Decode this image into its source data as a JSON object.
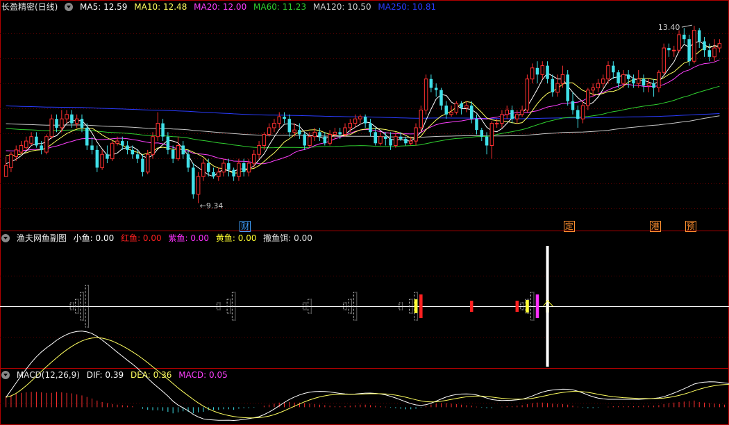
{
  "colors": {
    "bg": "#000000",
    "border": "#b00000",
    "grid": "#5a0000",
    "up": "#ff3030",
    "down": "#40e0e8",
    "ma5": "#ffffff",
    "ma10": "#ffff60",
    "ma20": "#ff40ff",
    "ma60": "#30d030",
    "ma120": "#c8c8c8",
    "ma250": "#2a3cff",
    "hong": "#ff2020",
    "zi": "#ff30ff",
    "huang": "#ffff30",
    "white": "#ffffff"
  },
  "main_header": {
    "title": "长盈精密(日线)",
    "ma5": "MA5: 12.59",
    "ma10": "MA10: 12.48",
    "ma20": "MA20: 12.00",
    "ma60": "MA60: 11.23",
    "ma120": "MA120: 10.50",
    "ma250": "MA250: 10.81"
  },
  "sub_header": {
    "title": "渔夫网鱼副图",
    "xiaoyu": "小鱼: 0.00",
    "hongyu": "红鱼: 0.00",
    "ziyu": "紫鱼: 0.00",
    "huangyu": "黄鱼: 0.00",
    "sayuer": "撒鱼饵: 0.00"
  },
  "macd_header": {
    "title": "MACD(12,26,9)",
    "dif": "DIF: 0.39",
    "dea": "DEA: 0.36",
    "macd": "MACD: 0.05"
  },
  "annotations": {
    "high_label": "13.40",
    "low_label": "9.34",
    "events": [
      {
        "text": "财",
        "bar": 47,
        "color": "#40a0ff"
      },
      {
        "text": "定",
        "bar": 111,
        "color": "#ff9030"
      },
      {
        "text": "港",
        "bar": 128,
        "color": "#ff9030"
      },
      {
        "text": "预",
        "bar": 135,
        "color": "#ff9030"
      }
    ]
  },
  "chart_data": [
    {
      "type": "candlestick",
      "name": "main",
      "y_range": [
        9.0,
        13.7
      ],
      "bars": [
        [
          10.0,
          10.25,
          10.1,
          10.45
        ],
        [
          10.2,
          10.5,
          10.1,
          10.55
        ],
        [
          10.45,
          10.6,
          10.35,
          10.7
        ],
        [
          10.55,
          10.7,
          10.5,
          10.8
        ],
        [
          10.65,
          10.8,
          10.6,
          10.9
        ],
        [
          10.75,
          10.9,
          10.7,
          11.0
        ],
        [
          10.9,
          10.7,
          10.65,
          11.0
        ],
        [
          10.7,
          10.6,
          10.5,
          10.8
        ],
        [
          10.55,
          10.9,
          10.5,
          10.95
        ],
        [
          10.9,
          11.3,
          10.85,
          11.4
        ],
        [
          11.3,
          11.1,
          11.0,
          11.4
        ],
        [
          11.1,
          11.3,
          11.0,
          11.5
        ],
        [
          11.3,
          11.4,
          11.2,
          11.5
        ],
        [
          11.4,
          11.2,
          11.1,
          11.5
        ],
        [
          11.2,
          11.3,
          11.1,
          11.4
        ],
        [
          11.3,
          11.1,
          11.0,
          11.4
        ],
        [
          11.1,
          10.7,
          10.6,
          11.2
        ],
        [
          10.7,
          10.6,
          10.5,
          10.9
        ],
        [
          10.6,
          10.2,
          10.1,
          10.7
        ],
        [
          10.2,
          10.5,
          10.15,
          10.6
        ],
        [
          10.5,
          10.4,
          10.3,
          10.7
        ],
        [
          10.4,
          10.75,
          10.35,
          10.8
        ],
        [
          10.75,
          10.8,
          10.7,
          10.9
        ],
        [
          10.8,
          10.7,
          10.6,
          10.9
        ],
        [
          10.7,
          10.6,
          10.5,
          10.8
        ],
        [
          10.6,
          10.5,
          10.4,
          10.7
        ],
        [
          10.5,
          10.4,
          10.3,
          10.6
        ],
        [
          10.4,
          10.1,
          10.0,
          10.5
        ],
        [
          10.1,
          10.5,
          10.05,
          10.6
        ],
        [
          10.5,
          10.9,
          10.4,
          11.0
        ],
        [
          10.9,
          11.2,
          10.8,
          11.45
        ],
        [
          11.2,
          10.9,
          10.8,
          11.3
        ],
        [
          10.9,
          10.6,
          10.5,
          11.0
        ],
        [
          10.6,
          10.4,
          10.3,
          10.7
        ],
        [
          10.4,
          10.7,
          10.35,
          10.9
        ],
        [
          10.7,
          10.5,
          10.4,
          10.8
        ],
        [
          10.5,
          10.2,
          10.1,
          10.6
        ],
        [
          10.2,
          9.6,
          9.5,
          10.3
        ],
        [
          9.6,
          10.0,
          9.4,
          10.1
        ],
        [
          10.0,
          10.3,
          9.9,
          10.4
        ],
        [
          10.3,
          10.1,
          10.0,
          10.4
        ],
        [
          10.1,
          10.0,
          9.95,
          10.2
        ],
        [
          10.0,
          10.1,
          9.9,
          10.2
        ],
        [
          10.1,
          10.3,
          10.0,
          10.4
        ],
        [
          10.3,
          10.15,
          10.0,
          10.4
        ],
        [
          10.15,
          10.0,
          9.9,
          10.2
        ],
        [
          10.0,
          10.3,
          9.9,
          10.4
        ],
        [
          10.3,
          10.1,
          10.0,
          10.4
        ],
        [
          10.1,
          10.3,
          10.0,
          10.4
        ],
        [
          10.3,
          10.5,
          10.2,
          10.6
        ],
        [
          10.5,
          10.7,
          10.4,
          10.8
        ],
        [
          10.7,
          10.95,
          10.6,
          11.0
        ],
        [
          10.95,
          11.1,
          10.9,
          11.2
        ],
        [
          11.1,
          11.2,
          11.0,
          11.3
        ],
        [
          11.2,
          11.35,
          11.1,
          11.45
        ],
        [
          11.35,
          11.3,
          11.2,
          11.45
        ],
        [
          11.3,
          11.0,
          10.9,
          11.4
        ],
        [
          11.0,
          11.05,
          10.9,
          11.2
        ],
        [
          11.05,
          10.95,
          10.85,
          11.2
        ],
        [
          10.95,
          10.7,
          10.6,
          11.0
        ],
        [
          10.7,
          10.9,
          10.65,
          11.0
        ],
        [
          10.9,
          11.0,
          10.8,
          11.1
        ],
        [
          11.0,
          10.9,
          10.8,
          11.1
        ],
        [
          10.9,
          10.75,
          10.7,
          11.0
        ],
        [
          10.75,
          10.95,
          10.7,
          11.05
        ],
        [
          10.95,
          11.0,
          10.85,
          11.1
        ],
        [
          11.0,
          10.95,
          10.85,
          11.1
        ],
        [
          10.95,
          11.1,
          10.9,
          11.2
        ],
        [
          11.1,
          11.2,
          11.0,
          11.3
        ],
        [
          11.2,
          11.3,
          11.1,
          11.4
        ],
        [
          11.3,
          11.35,
          11.2,
          11.4
        ],
        [
          11.35,
          11.2,
          11.1,
          11.4
        ],
        [
          11.2,
          11.0,
          10.9,
          11.3
        ],
        [
          11.0,
          10.75,
          10.7,
          11.1
        ],
        [
          10.75,
          10.9,
          10.7,
          11.0
        ],
        [
          10.9,
          10.85,
          10.7,
          11.0
        ],
        [
          10.85,
          10.7,
          10.6,
          11.0
        ],
        [
          10.7,
          10.9,
          10.65,
          11.0
        ],
        [
          10.9,
          10.85,
          10.8,
          11.0
        ],
        [
          10.85,
          10.75,
          10.7,
          10.9
        ],
        [
          10.75,
          10.8,
          10.7,
          10.9
        ],
        [
          10.8,
          11.1,
          10.7,
          11.2
        ],
        [
          11.1,
          11.5,
          11.0,
          11.6
        ],
        [
          11.5,
          12.2,
          11.4,
          12.3
        ],
        [
          12.2,
          12.0,
          11.9,
          12.3
        ],
        [
          12.0,
          11.95,
          11.8,
          12.1
        ],
        [
          11.95,
          11.6,
          11.5,
          12.0
        ],
        [
          11.6,
          11.4,
          11.3,
          11.7
        ],
        [
          11.4,
          11.45,
          11.35,
          11.6
        ],
        [
          11.45,
          11.65,
          11.4,
          11.7
        ],
        [
          11.65,
          11.55,
          11.4,
          11.7
        ],
        [
          11.55,
          11.6,
          11.45,
          11.7
        ],
        [
          11.6,
          11.3,
          11.2,
          11.7
        ],
        [
          11.3,
          11.05,
          10.95,
          11.4
        ],
        [
          11.05,
          10.9,
          10.8,
          11.1
        ],
        [
          10.9,
          10.7,
          10.5,
          11.0
        ],
        [
          10.7,
          11.2,
          10.4,
          11.25
        ],
        [
          11.2,
          11.2,
          11.1,
          11.3
        ],
        [
          11.2,
          11.4,
          11.1,
          11.5
        ],
        [
          11.4,
          11.5,
          11.3,
          11.6
        ],
        [
          11.5,
          11.3,
          11.2,
          11.6
        ],
        [
          11.3,
          11.4,
          11.2,
          11.5
        ],
        [
          11.4,
          11.5,
          11.35,
          11.6
        ],
        [
          11.5,
          12.2,
          11.45,
          12.3
        ],
        [
          12.2,
          12.45,
          12.1,
          12.55
        ],
        [
          12.45,
          12.3,
          12.1,
          12.6
        ],
        [
          12.3,
          12.5,
          12.2,
          12.6
        ],
        [
          12.5,
          12.2,
          12.1,
          12.6
        ],
        [
          12.2,
          11.9,
          11.8,
          12.3
        ],
        [
          11.9,
          12.1,
          11.8,
          12.3
        ],
        [
          12.1,
          12.3,
          12.0,
          12.5
        ],
        [
          12.3,
          11.7,
          11.6,
          12.4
        ],
        [
          11.7,
          11.5,
          11.4,
          11.9
        ],
        [
          11.5,
          11.3,
          11.1,
          11.6
        ],
        [
          11.3,
          11.6,
          11.2,
          11.7
        ],
        [
          11.6,
          11.95,
          11.5,
          12.0
        ],
        [
          11.95,
          12.0,
          11.8,
          12.1
        ],
        [
          12.0,
          12.1,
          11.9,
          12.2
        ],
        [
          12.1,
          12.2,
          12.0,
          12.3
        ],
        [
          12.2,
          12.5,
          12.1,
          12.6
        ],
        [
          12.5,
          12.35,
          12.2,
          12.6
        ],
        [
          12.35,
          12.1,
          12.0,
          12.4
        ],
        [
          12.1,
          12.3,
          12.0,
          12.4
        ],
        [
          12.3,
          12.2,
          12.0,
          12.4
        ],
        [
          12.2,
          12.1,
          12.0,
          12.3
        ],
        [
          12.1,
          12.2,
          12.0,
          12.4
        ],
        [
          12.2,
          12.05,
          11.9,
          12.3
        ],
        [
          12.05,
          12.1,
          11.9,
          12.2
        ],
        [
          12.1,
          12.0,
          11.8,
          12.2
        ],
        [
          12.0,
          12.35,
          11.9,
          12.4
        ],
        [
          12.35,
          12.9,
          12.3,
          13.0
        ],
        [
          12.9,
          12.85,
          12.7,
          13.0
        ],
        [
          12.85,
          12.85,
          12.7,
          12.95
        ],
        [
          12.85,
          13.2,
          12.8,
          13.3
        ],
        [
          13.2,
          13.1,
          13.0,
          13.35
        ],
        [
          13.1,
          12.6,
          12.5,
          13.2
        ],
        [
          12.6,
          13.3,
          12.55,
          13.4
        ],
        [
          13.3,
          13.05,
          12.9,
          13.35
        ],
        [
          13.05,
          12.85,
          12.7,
          13.15
        ],
        [
          12.85,
          12.7,
          12.6,
          13.0
        ],
        [
          12.7,
          12.9,
          12.6,
          13.1
        ],
        [
          12.9,
          13.0,
          12.8,
          13.1
        ]
      ]
    },
    {
      "type": "bar",
      "name": "macd",
      "y_range": [
        -0.32,
        0.52
      ],
      "values": [
        0.22,
        0.24,
        0.26,
        0.28,
        0.29,
        0.3,
        0.3,
        0.29,
        0.28,
        0.28,
        0.3,
        0.29,
        0.28,
        0.27,
        0.25,
        0.23,
        0.2,
        0.17,
        0.13,
        0.1,
        0.08,
        0.06,
        0.05,
        0.04,
        0.03,
        0.02,
        0.0,
        -0.03,
        -0.05,
        -0.06,
        -0.06,
        -0.07,
        -0.09,
        -0.12,
        -0.1,
        -0.08,
        -0.09,
        -0.12,
        -0.1,
        -0.09,
        -0.06,
        -0.05,
        -0.05,
        -0.04,
        -0.04,
        -0.05,
        -0.03,
        -0.02,
        -0.02,
        -0.01,
        0.0,
        0.03,
        0.05,
        0.07,
        0.09,
        0.1,
        0.1,
        0.09,
        0.09,
        0.08,
        0.07,
        0.06,
        0.05,
        0.04,
        0.03,
        0.02,
        0.02,
        0.02,
        0.03,
        0.04,
        0.05,
        0.05,
        0.04,
        0.03,
        0.02,
        0.01,
        -0.01,
        -0.02,
        -0.03,
        -0.04,
        -0.04,
        -0.03,
        -0.01,
        0.02,
        0.05,
        0.07,
        0.08,
        0.08,
        0.07,
        0.06,
        0.05,
        0.04,
        0.03,
        0.01,
        -0.01,
        -0.02,
        -0.02,
        0.0,
        0.01,
        0.02,
        0.02,
        0.03,
        0.04,
        0.06,
        0.08,
        0.09,
        0.09,
        0.08,
        0.07,
        0.06,
        0.06,
        0.05,
        0.03,
        0.01,
        -0.01,
        -0.02,
        -0.02,
        -0.01,
        0.0,
        0.01,
        0.02,
        0.02,
        0.02,
        0.02,
        0.02,
        0.02,
        0.03,
        0.03,
        0.03,
        0.04,
        0.06,
        0.08,
        0.09,
        0.1,
        0.11,
        0.12,
        0.13,
        0.1,
        0.09,
        0.08,
        0.07,
        0.06,
        0.05,
        0.05
      ]
    }
  ]
}
